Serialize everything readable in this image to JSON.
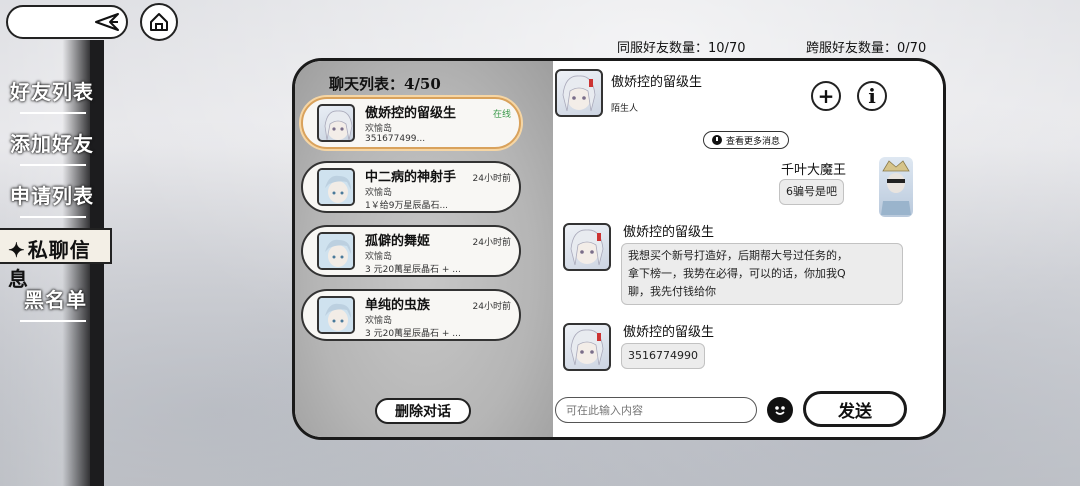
{
  "header": {
    "same_server_label": "同服好友数量：",
    "same_server_count": "10/70",
    "cross_server_label": "跨服好友数量：",
    "cross_server_count": "0/70"
  },
  "sidebar": {
    "items": [
      {
        "label": "好友列表"
      },
      {
        "label": "添加好友"
      },
      {
        "label": "申请列表"
      },
      {
        "label": "私聊信息"
      },
      {
        "label": "黑名单"
      }
    ],
    "active_marker": "✦"
  },
  "chat_list": {
    "title": "聊天列表：4/50",
    "items": [
      {
        "name": "傲娇控的留级生",
        "server": "欢愉岛",
        "snippet": "351677499...",
        "status": "在线"
      },
      {
        "name": "中二病的神射手",
        "server": "欢愉岛",
        "snippet": "1￥给9万星辰晶石...",
        "time": "24小时前"
      },
      {
        "name": "孤僻的舞姬",
        "server": "欢愉岛",
        "snippet": "3 元20萬星辰晶石 + ...",
        "time": "24小时前"
      },
      {
        "name": "单纯的虫族",
        "server": "欢愉岛",
        "snippet": "3 元20萬星辰晶石 + ...",
        "time": "24小时前"
      }
    ],
    "delete_label": "删除对话"
  },
  "chat": {
    "partner_name": "傲娇控的留级生",
    "partner_relation": "陌生人",
    "add_icon": "+",
    "info_icon": "i",
    "more_messages": "查看更多消息",
    "messages": [
      {
        "sender": "千叶大魔王",
        "text": "6骗号是吧",
        "side": "right"
      },
      {
        "sender": "傲娇控的留级生",
        "lines": [
          "我想买个新号打造好，后期帮大号过任务的，",
          "拿下榜一，我势在必得，可以的话，你加我Q",
          "聊，我先付钱给你"
        ],
        "side": "left"
      },
      {
        "sender": "傲娇控的留级生",
        "text": "3516774990",
        "side": "left"
      }
    ],
    "input_placeholder": "可在此输入内容",
    "send_label": "发送"
  },
  "colors": {
    "online": "#3a9a4a",
    "selected_border": "#d9a25c",
    "ink": "#1a1a1a"
  }
}
